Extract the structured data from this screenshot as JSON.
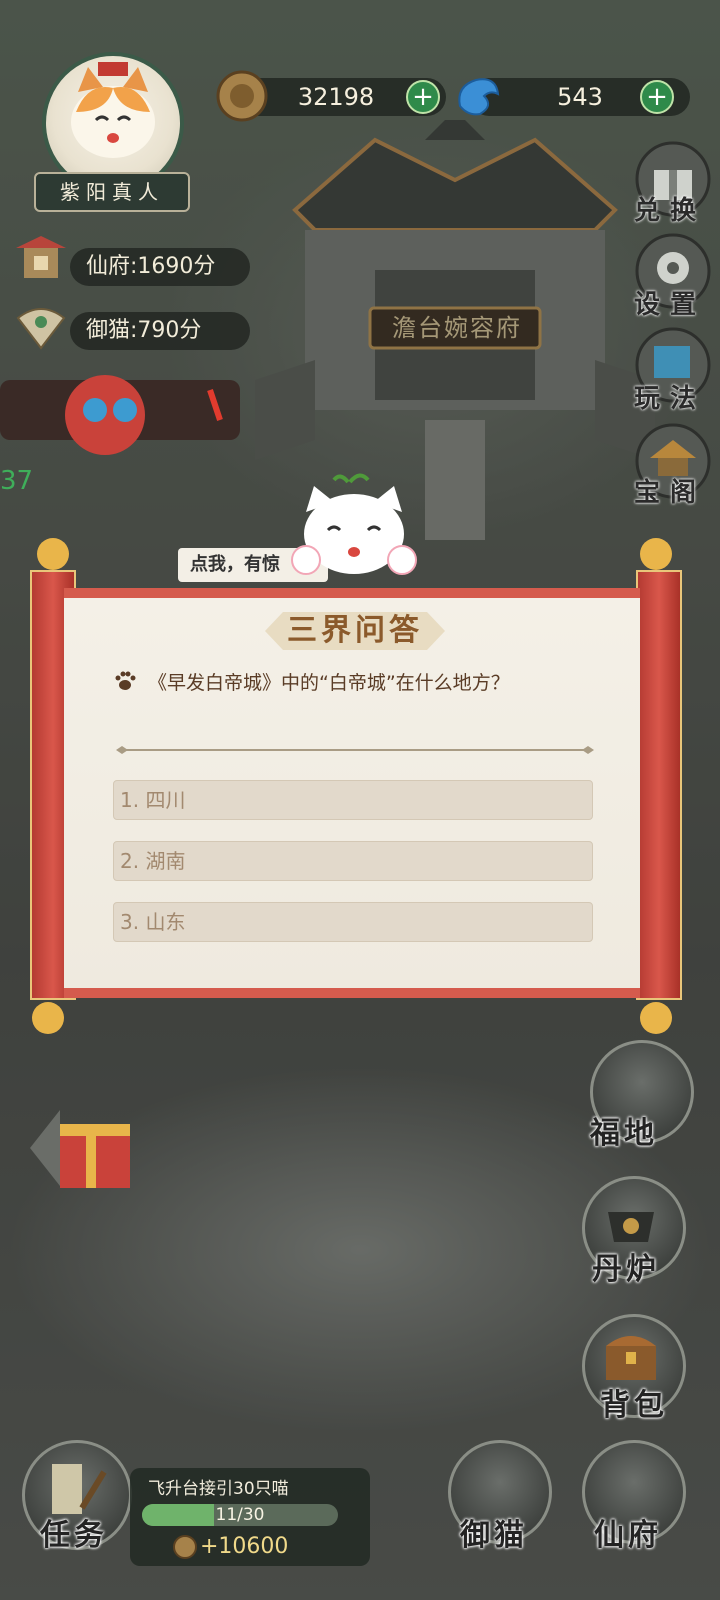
{
  "player": {
    "name": "紫阳真人",
    "xianfu_score": "仙府:1690分",
    "yumao_score": "御猫:790分"
  },
  "currency": {
    "coins": "32198",
    "gems": "543"
  },
  "side_menu": {
    "exchange": "兑换",
    "settings": "设置",
    "gameplay": "玩法",
    "treasure": "宝阁"
  },
  "scene": {
    "palace_sign": "澹台婉容府",
    "left_counter": "37",
    "speech_bubble": "点我，有惊"
  },
  "quiz": {
    "title": "三界问答",
    "question": "《早发白帝城》中的“白帝城”在什么地方？",
    "options": [
      "1. 四川",
      "2. 湖南",
      "3. 山东"
    ]
  },
  "bottom": {
    "fudi": "福地",
    "danlu": "丹炉",
    "beibao": "背包",
    "task_label": "任务",
    "task_title": "飞升台接引30只喵",
    "task_progress_text": "11/30",
    "task_progress": 0.367,
    "task_reward": "+10600",
    "yumao": "御猫",
    "xianfu": "仙府"
  },
  "colors": {
    "scroll_red": "#d55b4d",
    "paper": "#f4f0e7",
    "title_brown": "#8b5a2b",
    "option_bg": "#e2d9cb",
    "plus_green": "#2f8a4a"
  }
}
